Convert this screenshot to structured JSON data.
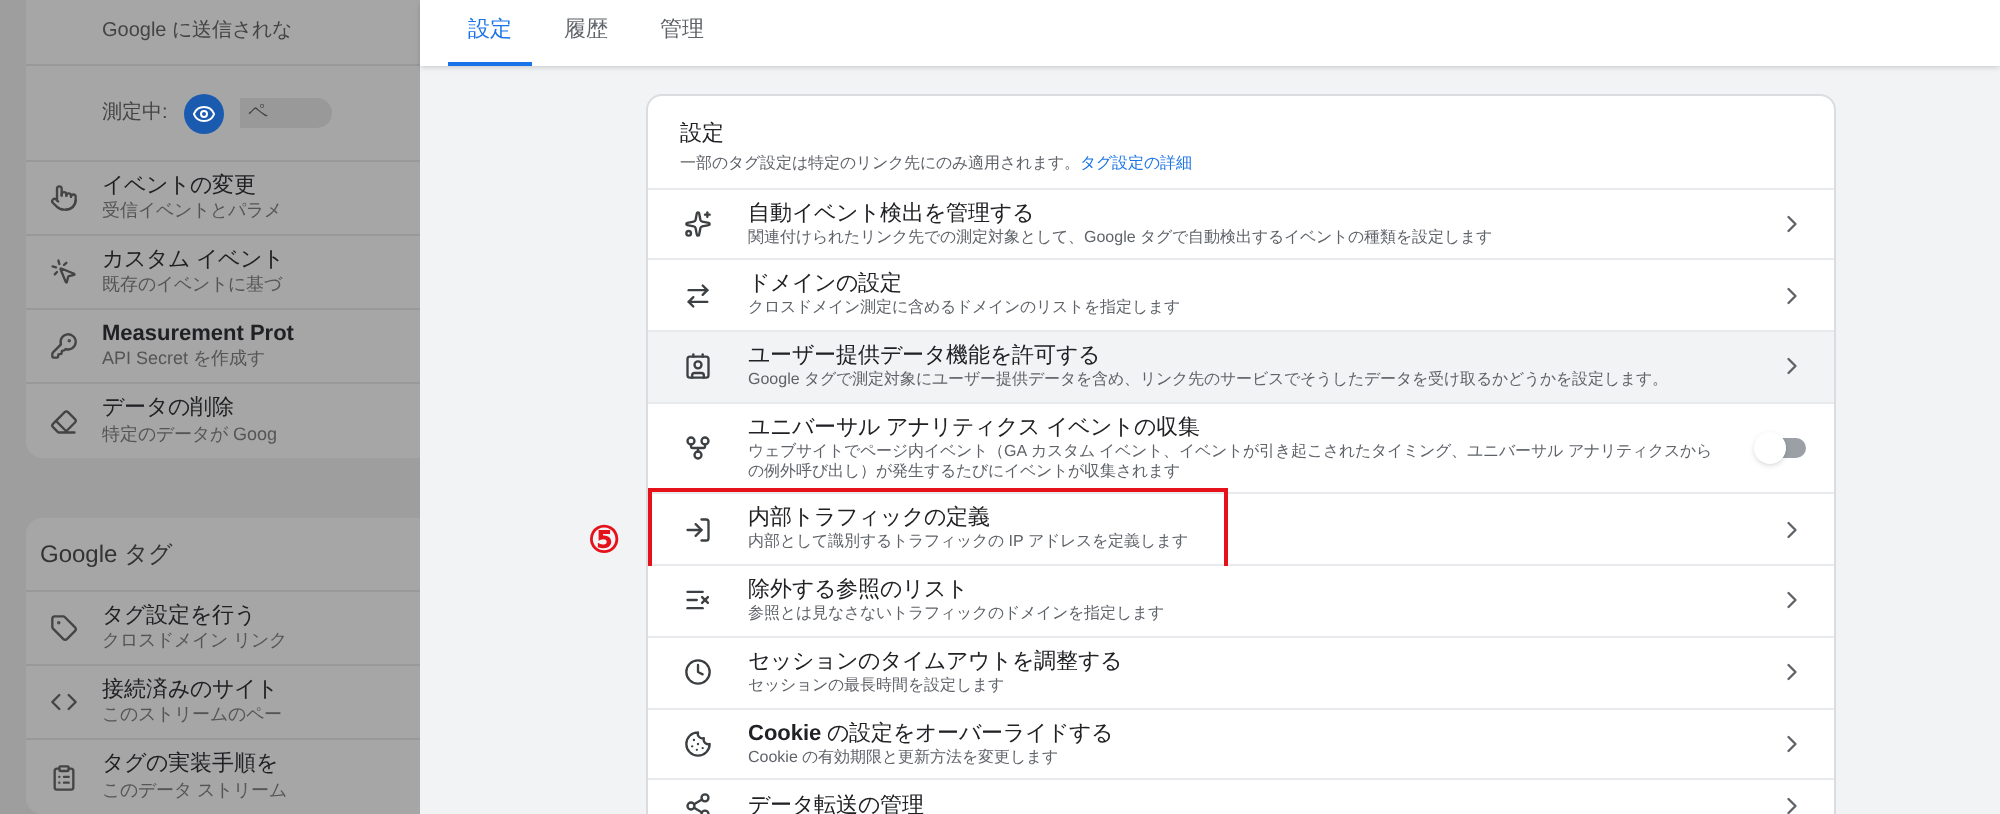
{
  "background_page": {
    "top_card": {
      "text": "Google に送信されな",
      "measuring_label": "測定中:",
      "measuring_value": "ペ"
    },
    "items": [
      {
        "title": "イベントの変更",
        "description": "受信イベントとパラメ",
        "bold": false
      },
      {
        "title": "カスタム イベント",
        "description": "既存のイベントに基づ",
        "bold": false
      },
      {
        "title": "Measurement Prot",
        "description": "API Secret を作成す",
        "bold": true
      },
      {
        "title": "データの削除",
        "description": "特定のデータが Goog",
        "bold": false
      }
    ],
    "google_tag_card": {
      "title": "Google タグ",
      "items": [
        {
          "title": "タグ設定を行う",
          "description": "クロスドメイン リンク"
        },
        {
          "title": "接続済みのサイト",
          "description": "このストリームのペー"
        },
        {
          "title": "タグの実装手順を",
          "description": "このデータ ストリーム"
        }
      ]
    }
  },
  "tabs": [
    {
      "label": "設定",
      "selected": true
    },
    {
      "label": "履歴",
      "selected": false
    },
    {
      "label": "管理",
      "selected": false
    }
  ],
  "settings_card": {
    "title": "設定",
    "description": "一部のタグ設定は特定のリンク先にのみ適用されます。",
    "link": "タグ設定の詳細",
    "rows": [
      {
        "kind": "link",
        "title": "自動イベント検出を管理する",
        "description": "関連付けられたリンク先での測定対象として、Google タグで自動検出するイベントの種類を設定します",
        "highlighted": false
      },
      {
        "kind": "link",
        "title": "ドメインの設定",
        "description": "クロスドメイン測定に含めるドメインのリストを指定します",
        "highlighted": false
      },
      {
        "kind": "link",
        "title": "ユーザー提供データ機能を許可する",
        "description": "Google タグで測定対象にユーザー提供データを含め、リンク先のサービスでそうしたデータを受け取るかどうかを設定します。",
        "highlighted": true
      },
      {
        "kind": "toggle",
        "title": "ユニバーサル アナリティクス イベントの収集",
        "description": "ウェブサイトでページ内イベント（GA カスタム イベント、イベントが引き起こされたタイミング、ユニバーサル アナリティクスからの例外呼び出し）が発生するたびにイベントが収集されます",
        "highlighted": false,
        "on": false
      },
      {
        "kind": "link",
        "title": "内部トラフィックの定義",
        "description": "内部として識別するトラフィックの IP アドレスを定義します",
        "highlighted": false,
        "annotation": "⑤"
      },
      {
        "kind": "link",
        "title": "除外する参照のリスト",
        "description": "参照とは見なさないトラフィックのドメインを指定します",
        "highlighted": false
      },
      {
        "kind": "link",
        "title": "セッションのタイムアウトを調整する",
        "description": "セッションの最長時間を設定します",
        "highlighted": false
      },
      {
        "kind": "link",
        "title": "**Cookie** の設定をオーバーライドする",
        "description": "Cookie の有効期限と更新方法を変更します",
        "highlighted": false
      },
      {
        "kind": "link",
        "title": "データ転送の管理",
        "highlighted": false
      }
    ]
  }
}
